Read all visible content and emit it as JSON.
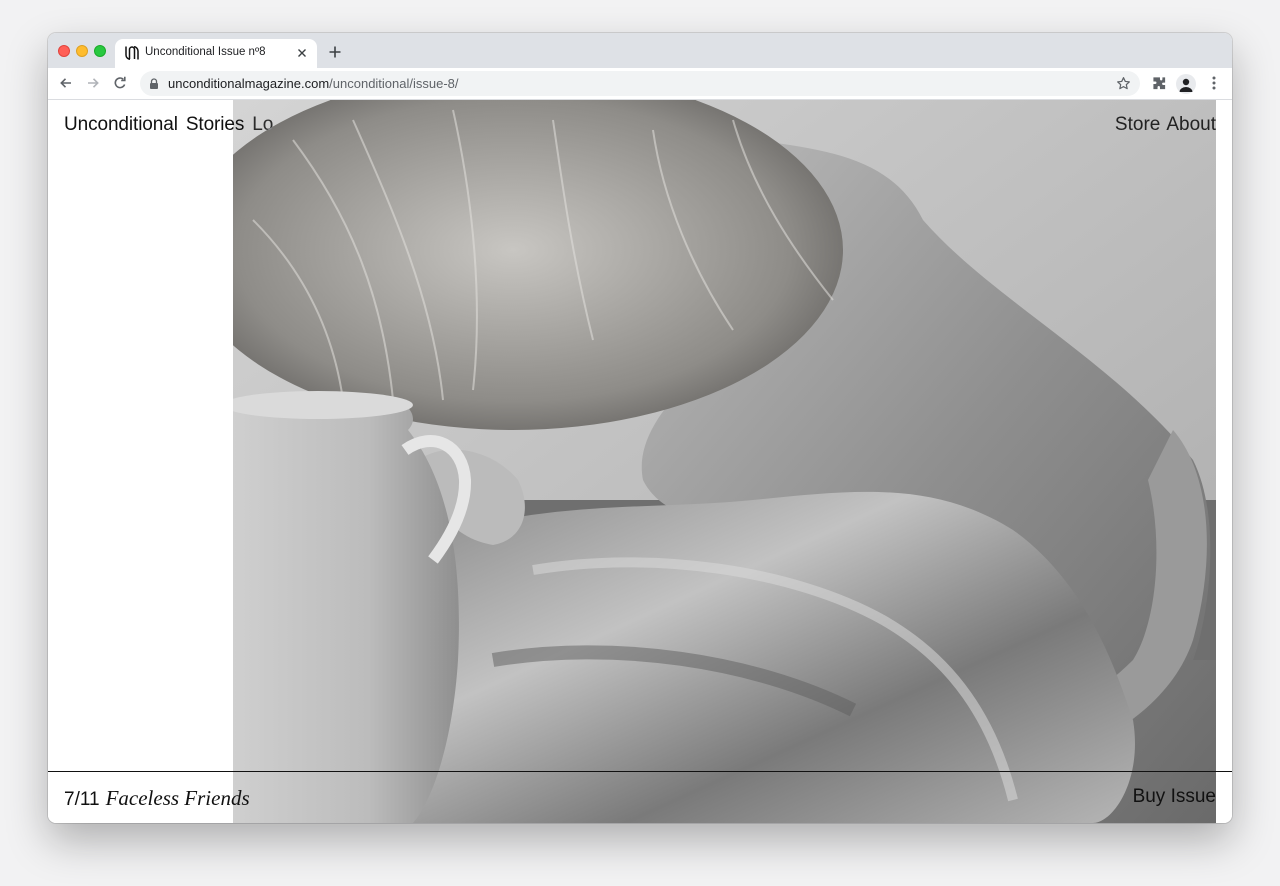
{
  "browser": {
    "tab_title": "Unconditional Issue nº8",
    "url_host": "unconditionalmagazine.com",
    "url_path": "/unconditional/issue-8/"
  },
  "site": {
    "brand": "Unconditional",
    "nav_left": [
      "Stories",
      "Lo"
    ],
    "nav_right": [
      "Store",
      "About"
    ]
  },
  "footer": {
    "counter": "7/11",
    "story_title": "Faceless Friends",
    "buy_label": "Buy Issue"
  },
  "colors": {
    "tab_strip": "#dee1e6",
    "omnibox": "#f1f3f4",
    "text": "#111111"
  },
  "icons": [
    "back-arrow-icon",
    "forward-arrow-icon",
    "reload-icon",
    "lock-icon",
    "star-icon",
    "extensions-icon",
    "profile-avatar-icon",
    "kebab-menu-icon"
  ]
}
